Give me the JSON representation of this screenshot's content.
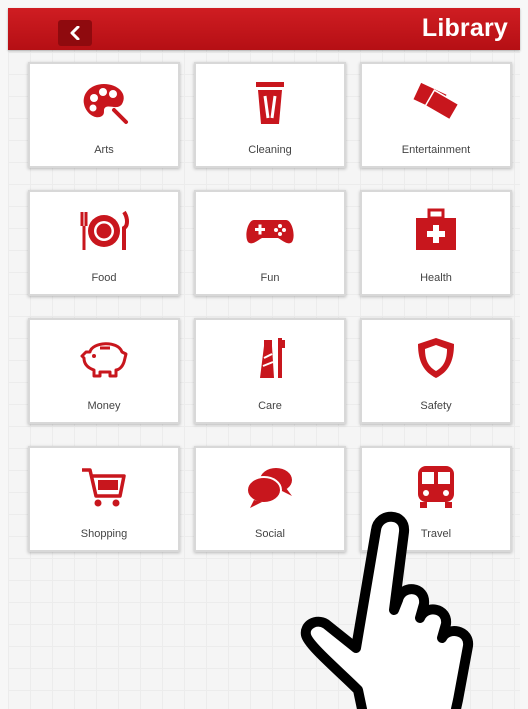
{
  "header": {
    "title": "Library",
    "back_icon": "chevron-left-icon",
    "color": "#c8161d"
  },
  "tiles": [
    {
      "label": "Arts",
      "icon": "palette-icon"
    },
    {
      "label": "Cleaning",
      "icon": "trash-can-icon"
    },
    {
      "label": "Entertainment",
      "icon": "tickets-icon"
    },
    {
      "label": "Food",
      "icon": "plate-cutlery-icon"
    },
    {
      "label": "Fun",
      "icon": "gamepad-icon"
    },
    {
      "label": "Health",
      "icon": "first-aid-kit-icon"
    },
    {
      "label": "Money",
      "icon": "piggy-bank-icon"
    },
    {
      "label": "Care",
      "icon": "toothbrush-toothpaste-icon"
    },
    {
      "label": "Safety",
      "icon": "shield-icon"
    },
    {
      "label": "Shopping",
      "icon": "shopping-cart-icon"
    },
    {
      "label": "Social",
      "icon": "speech-bubbles-icon"
    },
    {
      "label": "Travel",
      "icon": "bus-icon"
    }
  ],
  "icon_color": "#c8161d",
  "overlay": {
    "icon": "pointing-hand-icon"
  }
}
